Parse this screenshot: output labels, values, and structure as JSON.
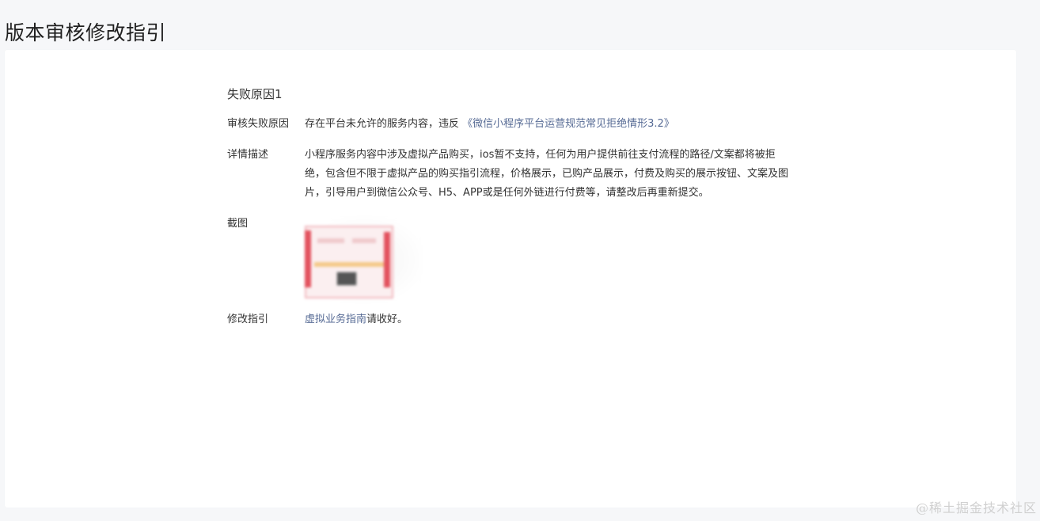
{
  "page": {
    "title": "版本审核修改指引"
  },
  "failure": {
    "section_title": "失败原因1",
    "reason_label": "审核失败原因",
    "reason_text": "存在平台未允许的服务内容，违反 ",
    "reason_link": "《微信小程序平台运营规范常见拒绝情形3.2》",
    "detail_label": "详情描述",
    "detail_text": "小程序服务内容中涉及虚拟产品购买，ios暂不支持，任何为用户提供前往支付流程的路径/文案都将被拒绝，包含但不限于虚拟产品的购买指引流程，价格展示，已购产品展示，付费及购买的展示按钮、文案及图片，引导用户到微信公众号、H5、APP或是任何外链进行付费等，请整改后再重新提交。",
    "screenshot_label": "截图",
    "guide_label": "修改指引",
    "guide_link": "虚拟业务指南",
    "guide_suffix": "请收好。"
  },
  "colors": {
    "link": "#576b95",
    "background": "#f6f7f9",
    "card": "#ffffff"
  },
  "watermark": "@稀土掘金技术社区"
}
